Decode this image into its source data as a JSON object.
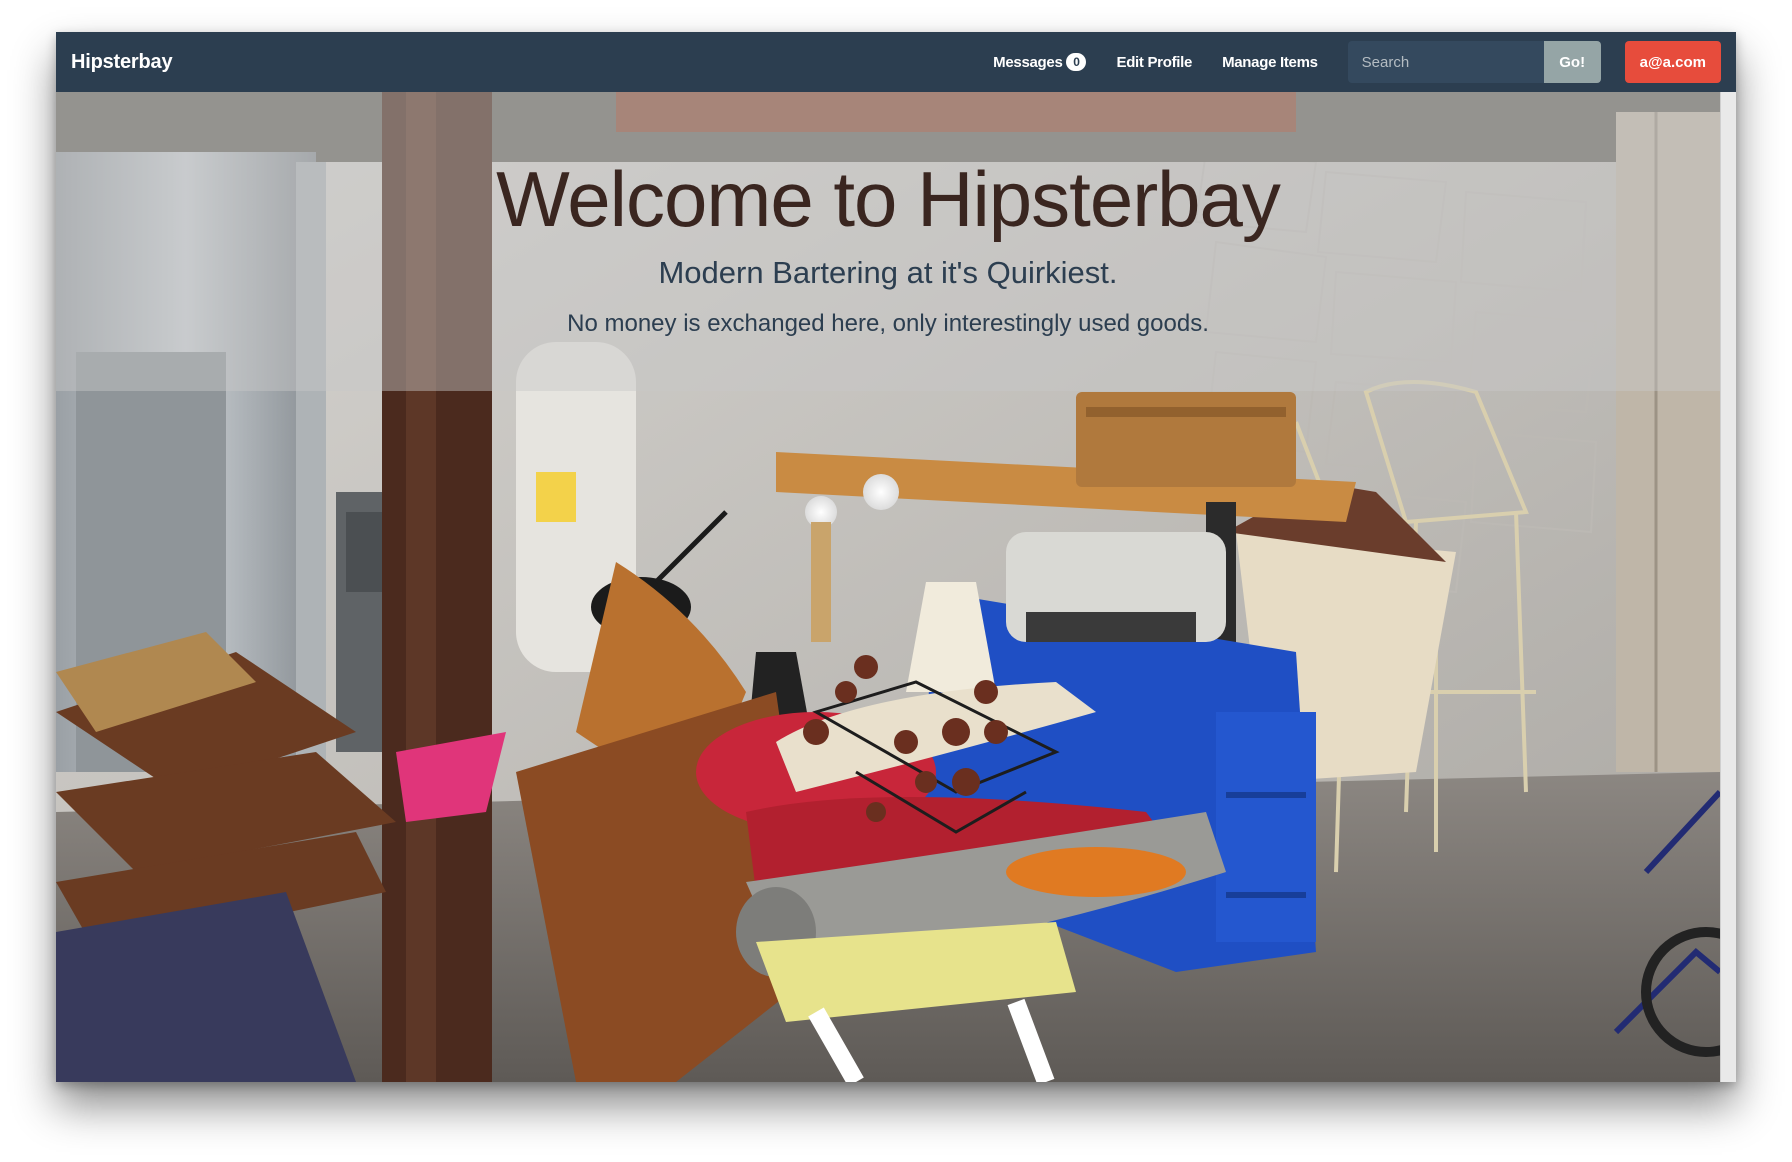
{
  "navbar": {
    "brand": "Hipsterbay",
    "messages_label": "Messages",
    "messages_count": "0",
    "edit_profile": "Edit Profile",
    "manage_items": "Manage Items",
    "search_placeholder": "Search",
    "go_button": "Go!",
    "user_email": "a@a.com"
  },
  "hero": {
    "title": "Welcome to Hipsterbay",
    "subtitle": "Modern Bartering at it's Quirkiest.",
    "tagline": "No money is exchanged here, only interestingly used goods."
  },
  "background_image": {
    "icon": "vintage-basement-photo"
  },
  "colors": {
    "navbar": "#2c3e50",
    "search_field": "#34495e",
    "go_button": "#95a5a6",
    "user_button": "#e74c3c",
    "title_text": "#3a2620",
    "subtitle_text": "#2c3e50"
  }
}
